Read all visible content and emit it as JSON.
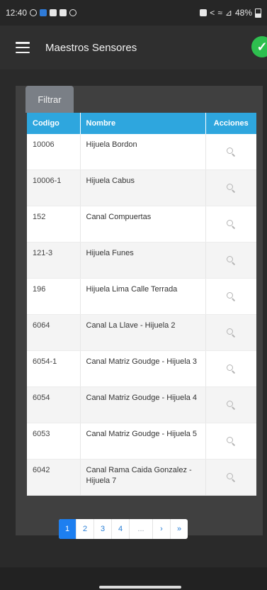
{
  "status_bar": {
    "time": "12:40",
    "battery": "48%"
  },
  "app_bar": {
    "title": "Maestros Sensores"
  },
  "filter": {
    "label": "Filtrar"
  },
  "table": {
    "headers": {
      "codigo": "Codigo",
      "nombre": "Nombre",
      "acciones": "Acciones"
    },
    "rows": [
      {
        "codigo": "10006",
        "nombre": "Hijuela Bordon"
      },
      {
        "codigo": "10006-1",
        "nombre": "Hijuela Cabus"
      },
      {
        "codigo": "152",
        "nombre": "Canal Compuertas"
      },
      {
        "codigo": "121-3",
        "nombre": "Hijuela Funes"
      },
      {
        "codigo": "196",
        "nombre": "Hijuela Lima Calle Terrada"
      },
      {
        "codigo": "6064",
        "nombre": "Canal La Llave - Hijuela 2"
      },
      {
        "codigo": "6054-1",
        "nombre": "Canal Matriz Goudge - Hijuela 3"
      },
      {
        "codigo": "6054",
        "nombre": "Canal Matriz Goudge - Hijuela 4"
      },
      {
        "codigo": "6053",
        "nombre": "Canal Matriz Goudge - Hijuela 5"
      },
      {
        "codigo": "6042",
        "nombre": "Canal Rama Caida Gonzalez - Hijuela 7"
      }
    ]
  },
  "pagination": {
    "pages": [
      "1",
      "2",
      "3",
      "4",
      "...",
      "›",
      "»"
    ],
    "active": "1"
  },
  "colors": {
    "header_bg": "#2ea6de",
    "active_page": "#1d7ff0",
    "check_badge": "#2ebf4f"
  }
}
